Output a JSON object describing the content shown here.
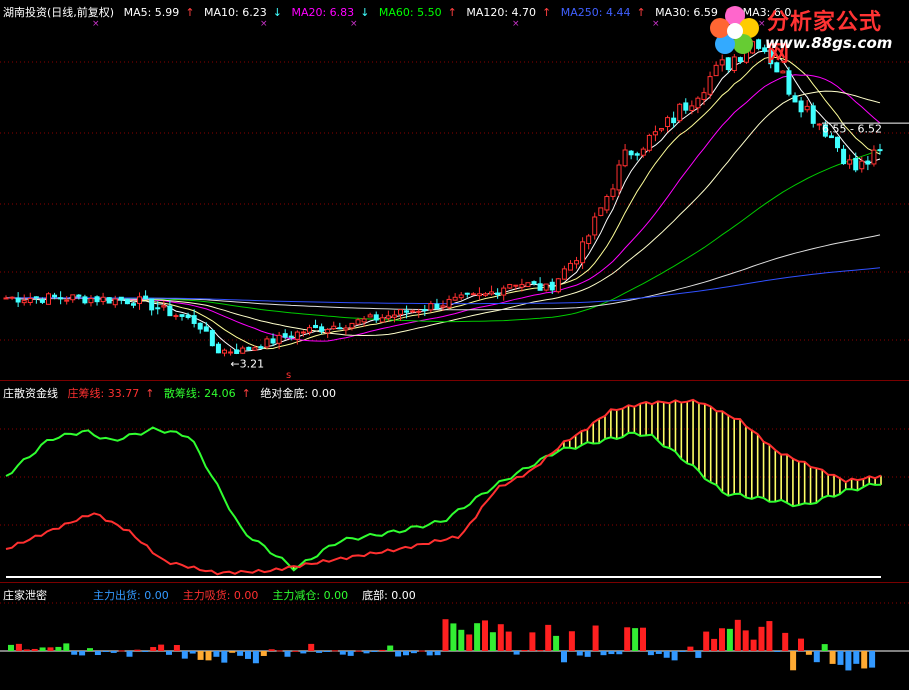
{
  "main": {
    "title": "湖南投资(日线,前复权)",
    "ma": [
      {
        "label": "MA5: 5.99",
        "color": "#ffffff",
        "arrow": "↑",
        "arrow_color": "#ff4040"
      },
      {
        "label": "MA10: 6.23",
        "color": "#ffffff",
        "arrow": "↓",
        "arrow_color": "#40ffff"
      },
      {
        "label": "MA20: 6.83",
        "color": "#ff00ff",
        "arrow": "↓",
        "arrow_color": "#40ffff"
      },
      {
        "label": "MA60: 5.50",
        "color": "#00ff00",
        "arrow": "↑",
        "arrow_color": "#ff4040"
      },
      {
        "label": "MA120: 4.70",
        "color": "#ffffff",
        "arrow": "↑",
        "arrow_color": "#ff4040"
      },
      {
        "label": "MA250: 4.44",
        "color": "#4060ff",
        "arrow": "↑",
        "arrow_color": "#ff4040"
      },
      {
        "label": "MA30: 6.59",
        "color": "#ffffff",
        "arrow": "↑",
        "arrow_color": "#ff4040"
      },
      {
        "label": "MA3: 6.0",
        "color": "#ffffff",
        "arrow": "",
        "arrow_color": "#ff4040"
      }
    ],
    "low_label": "3.21",
    "high_label": "6.55 - 6.52",
    "marker": "s"
  },
  "watermark": {
    "title": "分析家公式网",
    "url": "www.88gs.com"
  },
  "indicator1": {
    "name": "庄散资金线",
    "items": [
      {
        "label": "庄筹线: 33.77",
        "color": "#ff3030",
        "arrow": "↑"
      },
      {
        "label": "散筹线: 24.06",
        "color": "#30ff30",
        "arrow": "↑"
      },
      {
        "label": "绝对金底: 0.00",
        "color": "#ffffff",
        "arrow": ""
      }
    ]
  },
  "indicator2": {
    "name": "庄家泄密",
    "items": [
      {
        "label": "主力出货: 0.00",
        "color": "#3399ff"
      },
      {
        "label": "主力吸货: 0.00",
        "color": "#ff3030"
      },
      {
        "label": "主力减仓: 0.00",
        "color": "#30ff30"
      },
      {
        "label": "底部: 0.00",
        "color": "#ffffff"
      }
    ]
  },
  "colors": {
    "up": "#ff3030",
    "down": "#40ffff",
    "grid": "#8b0000",
    "zhuang": "#ff3030",
    "san": "#30ff30",
    "fill": "#ffff66"
  },
  "chart_data": [
    {
      "type": "line",
      "title": "湖南投资(日线,前复权)",
      "series": [
        {
          "name": "MA5",
          "values": [
            5.99
          ]
        },
        {
          "name": "MA10",
          "values": [
            6.23
          ]
        },
        {
          "name": "MA20",
          "values": [
            6.83
          ]
        },
        {
          "name": "MA60",
          "values": [
            5.5
          ]
        },
        {
          "name": "MA120",
          "values": [
            4.7
          ]
        },
        {
          "name": "MA250",
          "values": [
            4.44
          ]
        },
        {
          "name": "MA30",
          "values": [
            6.59
          ]
        }
      ]
    },
    {
      "type": "line",
      "title": "庄散资金线",
      "series": [
        {
          "name": "庄筹线",
          "values": [
            33.77
          ]
        },
        {
          "name": "散筹线",
          "values": [
            24.06
          ]
        },
        {
          "name": "绝对金底",
          "values": [
            0.0
          ]
        }
      ]
    },
    {
      "type": "bar",
      "title": "庄家泄密",
      "series": [
        {
          "name": "主力出货",
          "values": [
            0.0
          ]
        },
        {
          "name": "主力吸货",
          "values": [
            0.0
          ]
        },
        {
          "name": "主力减仓",
          "values": [
            0.0
          ]
        },
        {
          "name": "底部",
          "values": [
            0.0
          ]
        }
      ]
    }
  ]
}
